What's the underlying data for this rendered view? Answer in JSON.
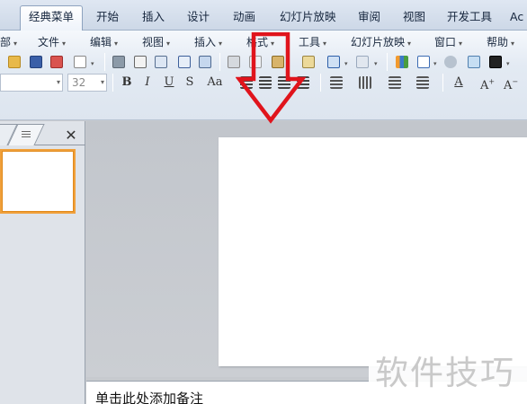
{
  "ribbon_tabs": [
    {
      "label": "经典菜单",
      "active": true
    },
    {
      "label": "开始"
    },
    {
      "label": "插入"
    },
    {
      "label": "设计"
    },
    {
      "label": "动画"
    },
    {
      "label": "幻灯片放映"
    },
    {
      "label": "审阅"
    },
    {
      "label": "视图"
    },
    {
      "label": "开发工具"
    },
    {
      "label": "Ac"
    }
  ],
  "menu": [
    {
      "label": "部"
    },
    {
      "label": "文件"
    },
    {
      "label": "编辑"
    },
    {
      "label": "视图"
    },
    {
      "label": "插入"
    },
    {
      "label": "格式"
    },
    {
      "label": "工具"
    },
    {
      "label": "幻灯片放映"
    },
    {
      "label": "窗口"
    },
    {
      "label": "帮助"
    }
  ],
  "font_size_combo": {
    "value": "32"
  },
  "format_buttons": {
    "bold": "B",
    "italic": "I",
    "underline": "U",
    "shadow": "S",
    "change_case": "Aa"
  },
  "left_pane": {
    "close_glyph": "✕"
  },
  "notes": {
    "placeholder": "单击此处添加备注"
  },
  "watermark": {
    "text": "软件技巧"
  },
  "colors": {
    "highlight_arrow": "#e0141c",
    "thumb_selection": "#f0a03a"
  },
  "icons": {
    "open": "folder-open-icon",
    "save": "save-icon",
    "permission": "permission-icon",
    "print": "print-icon",
    "print_preview": "print-preview-icon",
    "spelling": "spell-check-icon",
    "cut": "scissors-icon",
    "copy": "copy-icon",
    "paste": "paste-icon",
    "format_painter": "format-painter-icon",
    "undo": "undo-icon",
    "redo": "redo-icon",
    "chart": "chart-icon",
    "table": "table-icon"
  }
}
